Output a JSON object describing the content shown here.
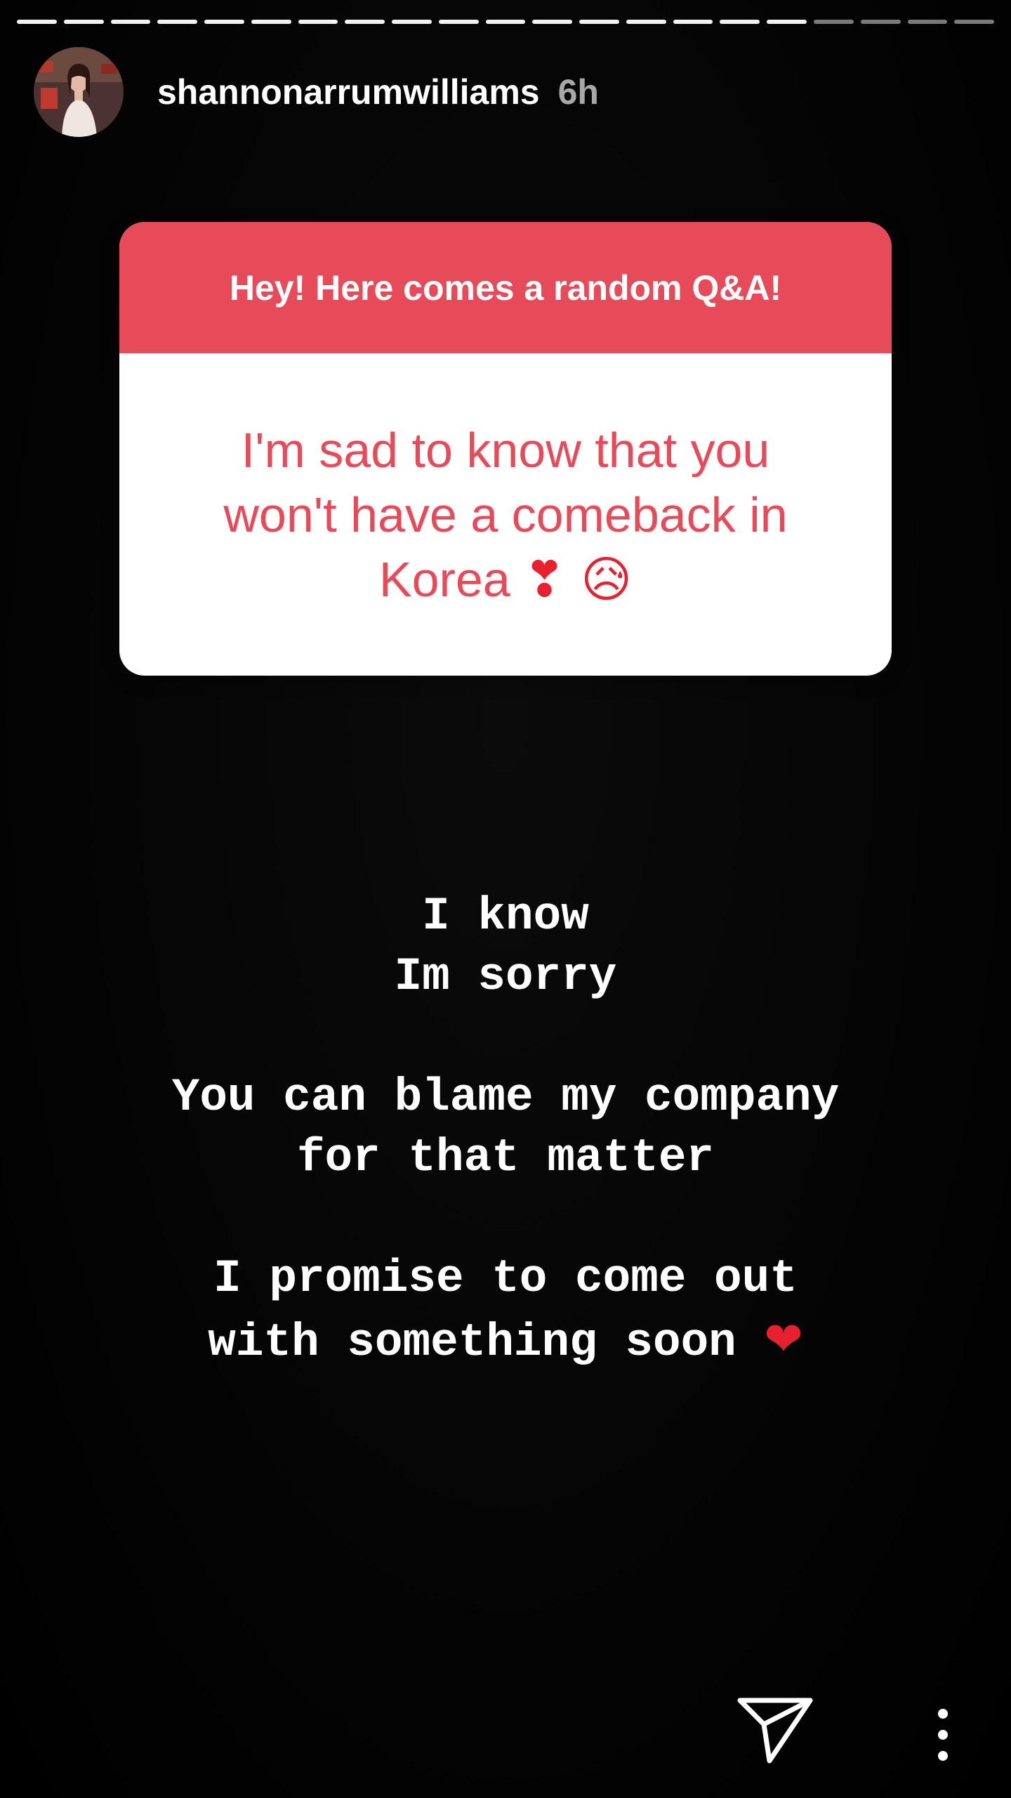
{
  "story": {
    "segments": {
      "total": 21,
      "viewed": 17,
      "colors": {
        "viewed": "#f2f2f2",
        "unseen": "#7a7a7a"
      }
    },
    "username": "shannonarrumwilliams",
    "time": "6h"
  },
  "qa_card": {
    "header": "Hey! Here comes a random Q&A!",
    "question_line_1": "I'm sad to know that you",
    "question_line_2": "won't have a comeback in",
    "question_line_3": "Korea",
    "question_emoji": "❣ 😥",
    "header_color": "#e74b5a",
    "body_text_color": "#e74b5a"
  },
  "caption": {
    "line_1": "I know",
    "line_2": "Im sorry",
    "line_3": "You can blame my company",
    "line_4": "for that matter",
    "line_5": "I promise to come out",
    "line_6": "with something soon",
    "line_6_emoji": "❤"
  },
  "icons": {
    "send": "paper-plane-icon",
    "more": "vertical-ellipsis-icon"
  }
}
